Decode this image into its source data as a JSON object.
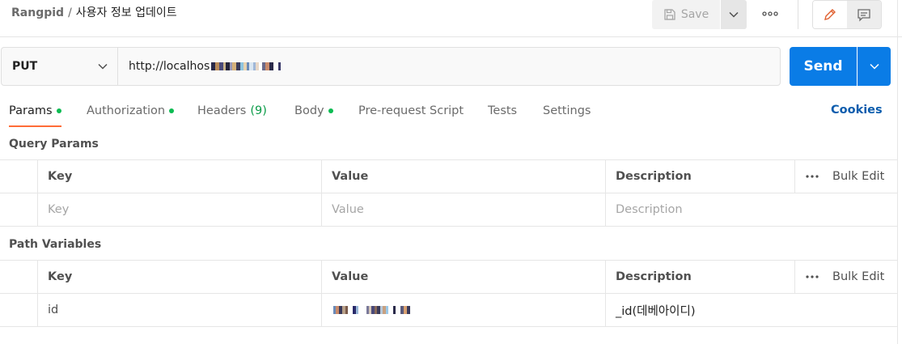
{
  "header": {
    "workspace": "Rangpid",
    "separator": "/",
    "request_name": "사용자 정보 업데이트",
    "save_label": "Save",
    "more_icon": "ellipsis-icon",
    "edit_icon": "pencil-icon",
    "comment_icon": "comment-icon"
  },
  "request": {
    "method": "PUT",
    "url_prefix": "http://localhos",
    "send_label": "Send"
  },
  "tabs": [
    {
      "label": "Params",
      "dot": true
    },
    {
      "label": "Authorization",
      "dot": true
    },
    {
      "label": "Headers",
      "count": "(9)"
    },
    {
      "label": "Body",
      "dot": true
    },
    {
      "label": "Pre-request Script"
    },
    {
      "label": "Tests"
    },
    {
      "label": "Settings"
    }
  ],
  "cookies_label": "Cookies",
  "query_params": {
    "title": "Query Params",
    "headers": {
      "key": "Key",
      "value": "Value",
      "description": "Description",
      "bulk_edit": "Bulk Edit"
    },
    "placeholder": {
      "key": "Key",
      "value": "Value",
      "description": "Description"
    }
  },
  "path_variables": {
    "title": "Path Variables",
    "headers": {
      "key": "Key",
      "value": "Value",
      "description": "Description",
      "bulk_edit": "Bulk Edit"
    },
    "rows": [
      {
        "key": "id",
        "description": "_id(데베아이디)"
      }
    ]
  },
  "colors": {
    "accent": "#ff6c37",
    "send": "#0a7ce6",
    "dot": "#0cbb52",
    "link": "#0b5cad"
  }
}
